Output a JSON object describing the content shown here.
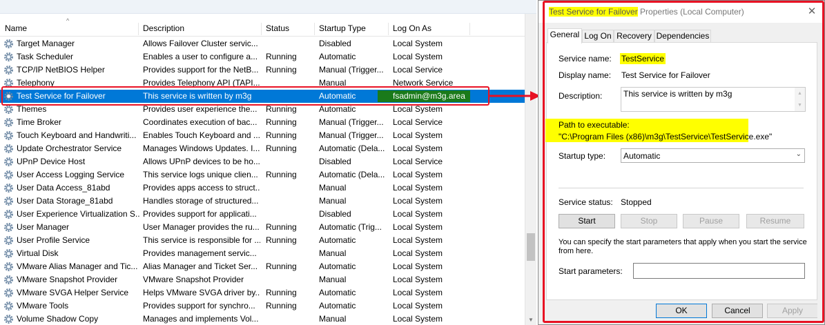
{
  "columns": {
    "name": "Name",
    "description": "Description",
    "status": "Status",
    "startup": "Startup Type",
    "logon": "Log On As"
  },
  "sort_arrow": "^",
  "services": [
    {
      "name": "Target Manager",
      "description": "Allows Failover Cluster servic...",
      "status": "",
      "startup": "Disabled",
      "logon": "Local System"
    },
    {
      "name": "Task Scheduler",
      "description": "Enables a user to configure a...",
      "status": "Running",
      "startup": "Automatic",
      "logon": "Local System"
    },
    {
      "name": "TCP/IP NetBIOS Helper",
      "description": "Provides support for the NetB...",
      "status": "Running",
      "startup": "Manual (Trigger...",
      "logon": "Local Service"
    },
    {
      "name": "Telephony",
      "description": "Provides Telephony API (TAPI...",
      "status": "",
      "startup": "Manual",
      "logon": "Network Service"
    },
    {
      "name": "Test Service for Failover",
      "description": "This service is written by m3g",
      "status": "",
      "startup": "Automatic",
      "logon": "fsadmin@m3g.area",
      "selected": true
    },
    {
      "name": "Themes",
      "description": "Provides user experience the...",
      "status": "Running",
      "startup": "Automatic",
      "logon": "Local System"
    },
    {
      "name": "Time Broker",
      "description": "Coordinates execution of bac...",
      "status": "Running",
      "startup": "Manual (Trigger...",
      "logon": "Local Service"
    },
    {
      "name": "Touch Keyboard and Handwriti...",
      "description": "Enables Touch Keyboard and ...",
      "status": "Running",
      "startup": "Manual (Trigger...",
      "logon": "Local System"
    },
    {
      "name": "Update Orchestrator Service",
      "description": "Manages Windows Updates. I...",
      "status": "Running",
      "startup": "Automatic (Dela...",
      "logon": "Local System"
    },
    {
      "name": "UPnP Device Host",
      "description": "Allows UPnP devices to be ho...",
      "status": "",
      "startup": "Disabled",
      "logon": "Local Service"
    },
    {
      "name": "User Access Logging Service",
      "description": "This service logs unique clien...",
      "status": "Running",
      "startup": "Automatic (Dela...",
      "logon": "Local System"
    },
    {
      "name": "User Data Access_81abd",
      "description": "Provides apps access to struct...",
      "status": "",
      "startup": "Manual",
      "logon": "Local System"
    },
    {
      "name": "User Data Storage_81abd",
      "description": "Handles storage of structured...",
      "status": "",
      "startup": "Manual",
      "logon": "Local System"
    },
    {
      "name": "User Experience Virtualization S...",
      "description": "Provides support for applicati...",
      "status": "",
      "startup": "Disabled",
      "logon": "Local System"
    },
    {
      "name": "User Manager",
      "description": "User Manager provides the ru...",
      "status": "Running",
      "startup": "Automatic (Trig...",
      "logon": "Local System"
    },
    {
      "name": "User Profile Service",
      "description": "This service is responsible for ...",
      "status": "Running",
      "startup": "Automatic",
      "logon": "Local System"
    },
    {
      "name": "Virtual Disk",
      "description": "Provides management servic...",
      "status": "",
      "startup": "Manual",
      "logon": "Local System"
    },
    {
      "name": "VMware Alias Manager and Tic...",
      "description": "Alias Manager and Ticket Ser...",
      "status": "Running",
      "startup": "Automatic",
      "logon": "Local System"
    },
    {
      "name": "VMware Snapshot Provider",
      "description": "VMware Snapshot Provider",
      "status": "",
      "startup": "Manual",
      "logon": "Local System"
    },
    {
      "name": "VMware SVGA Helper Service",
      "description": "Helps VMware SVGA driver by...",
      "status": "Running",
      "startup": "Automatic",
      "logon": "Local System"
    },
    {
      "name": "VMware Tools",
      "description": "Provides support for synchro...",
      "status": "Running",
      "startup": "Automatic",
      "logon": "Local System"
    },
    {
      "name": "Volume Shadow Copy",
      "description": "Manages and implements Vol...",
      "status": "",
      "startup": "Manual",
      "logon": "Local System"
    }
  ],
  "dialog": {
    "title_highlight": "Test Service for Failover",
    "title_rest": " Properties (Local Computer)",
    "close_glyph": "✕",
    "tabs": [
      "General",
      "Log On",
      "Recovery",
      "Dependencies"
    ],
    "labels": {
      "service_name": "Service name:",
      "display_name": "Display name:",
      "description": "Description:",
      "path": "Path to executable:",
      "startup_type": "Startup type:",
      "service_status": "Service status:",
      "start_params": "Start parameters:"
    },
    "values": {
      "service_name": "TestService",
      "display_name": "Test Service for Failover",
      "description": "This service is written by m3g",
      "path": "\"C:\\Program Files (x86)\\m3g\\TestService\\TestService.exe\"",
      "startup_type": "Automatic",
      "service_status": "Stopped",
      "start_params": ""
    },
    "hint": "You can specify the start parameters that apply when you start the service from here.",
    "buttons": {
      "start": "Start",
      "stop": "Stop",
      "pause": "Pause",
      "resume": "Resume",
      "ok": "OK",
      "cancel": "Cancel",
      "apply": "Apply"
    }
  }
}
